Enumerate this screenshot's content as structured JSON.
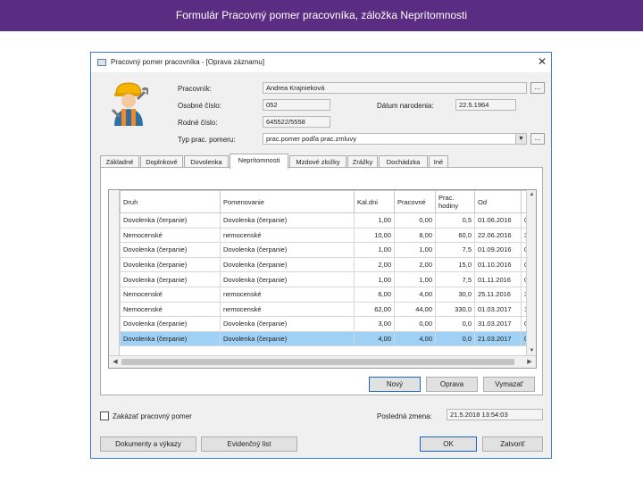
{
  "slide": {
    "title": "Formulár Pracovný pomer pracovníka, záložka Neprítomnosti"
  },
  "window": {
    "title": "Pracovný pomer pracovníka - [Oprava záznamu]",
    "close": "✕"
  },
  "form": {
    "pracovnik_label": "Pracovník:",
    "pracovnik_value": "Andrea Krajnieková",
    "osobne_cislo_label": "Osobné číslo:",
    "osobne_cislo_value": "052",
    "datum_narodenia_label": "Dátum narodenia:",
    "datum_narodenia_value": "22.5.1964",
    "rodne_cislo_label": "Rodné číslo:",
    "rodne_cislo_value": "645522/5558",
    "typ_pomeru_label": "Typ prac. pomeru:",
    "typ_pomeru_value": "prac.pomer podľa prac.zmluvy",
    "browse": "..."
  },
  "tabs": [
    "Základné",
    "Doplnkové",
    "Dovolenka",
    "Neprítomnosti",
    "Mzdové zložky",
    "Zrážky",
    "Dochádzka",
    "Iné"
  ],
  "table": {
    "columns": [
      "Druh",
      "Pomenovanie",
      "Kal.dni",
      "Pracovné",
      "Prac. hodiny",
      "Od",
      ""
    ],
    "rows": [
      [
        "Dovolenka (čerpanie)",
        "Dovolenka (čerpanie)",
        "1,00",
        "0,00",
        "0,5",
        "01.06.2016",
        "0"
      ],
      [
        "Nemocenské",
        "nemocenské",
        "10,00",
        "8,00",
        "60,0",
        "22.06.2016",
        "3"
      ],
      [
        "Dovolenka (čerpanie)",
        "Dovolenka (čerpanie)",
        "1,00",
        "1,00",
        "7,5",
        "01.09.2016",
        "0"
      ],
      [
        "Dovolenka (čerpanie)",
        "Dovolenka (čerpanie)",
        "2,00",
        "2,00",
        "15,0",
        "01.10.2016",
        "0"
      ],
      [
        "Dovolenka (čerpanie)",
        "Dovolenka (čerpanie)",
        "1,00",
        "1,00",
        "7,5",
        "01.11.2016",
        "0"
      ],
      [
        "Nemocenské",
        "nemocenské",
        "6,00",
        "4,00",
        "30,0",
        "25.11.2016",
        "3"
      ],
      [
        "Nemocenské",
        "nemocenské",
        "62,00",
        "44,00",
        "330,0",
        "01.03.2017",
        "1"
      ],
      [
        "Dovolenka (čerpanie)",
        "Dovolenka (čerpanie)",
        "3,00",
        "0,00",
        "0,0",
        "31.03.2017",
        "0"
      ],
      [
        "Dovolenka (čerpanie)",
        "Dovolenka (čerpanie)",
        "4,00",
        "4,00",
        "0,0",
        "21.03.2017",
        "0"
      ]
    ],
    "selected_row": 8
  },
  "buttons": {
    "novy": "Nový",
    "oprava": "Oprava",
    "vymazat": "Vymazať",
    "dokumenty": "Dokumenty a výkazy",
    "evidencny": "Evidenčný list",
    "ok": "OK",
    "zatvorit": "Zatvoriť"
  },
  "footer": {
    "zakazat_label": "Zakázať pracovný pomer",
    "zakazat_checked": false,
    "posledna_zmena_label": "Posledná zmena:",
    "posledna_zmena_value": "21.5.2018 13:54:03"
  },
  "icons": {
    "app": "window-icon",
    "worker": "worker-helmet-wrench-icon",
    "combo": "chevron-down-icon"
  }
}
